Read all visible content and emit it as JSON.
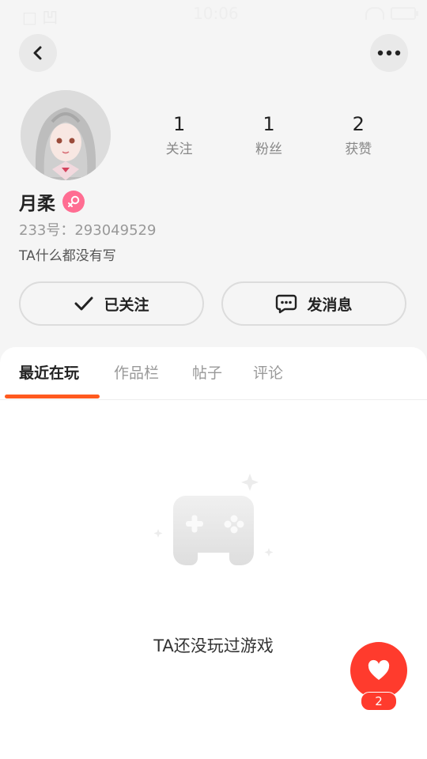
{
  "status_bar": {
    "carrier": "□ 凹",
    "time": "10:06"
  },
  "header": {
    "back_icon": "chevron-left-icon",
    "more_icon": "more-horizontal-icon"
  },
  "profile": {
    "name": "月柔",
    "uid": "233号：293049529",
    "bio": "TA什么都没有写",
    "gender_color": "#ff6d92"
  },
  "stats": [
    {
      "value": "1",
      "label": "关注"
    },
    {
      "value": "1",
      "label": "粉丝"
    },
    {
      "value": "2",
      "label": "获赞"
    }
  ],
  "actions": {
    "follow_label": "已关注",
    "message_label": "发消息"
  },
  "tabs": [
    {
      "label": "最近在玩",
      "active": true
    },
    {
      "label": "作品栏",
      "active": false
    },
    {
      "label": "帖子",
      "active": false
    },
    {
      "label": "评论",
      "active": false
    }
  ],
  "empty_state": {
    "text": "TA还没玩过游戏",
    "icon": "gamepad-icon"
  },
  "fab": {
    "icon": "heart-icon",
    "count": "2"
  },
  "colors": {
    "accent": "#ff5a1f",
    "fab": "#ff3b2d"
  }
}
